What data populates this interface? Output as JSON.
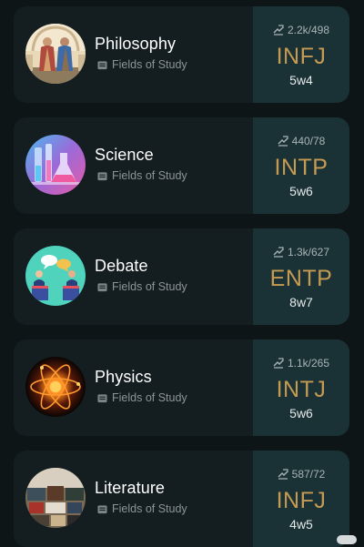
{
  "cards": [
    {
      "name": "Philosophy",
      "category": "Fields of Study",
      "votes": "2.2k/498",
      "type": "INFJ",
      "enneagram": "5w4",
      "avatar_icon": "philosophers-painting-avatar"
    },
    {
      "name": "Science",
      "category": "Fields of Study",
      "votes": "440/78",
      "type": "INTP",
      "enneagram": "5w6",
      "avatar_icon": "lab-glassware-avatar"
    },
    {
      "name": "Debate",
      "category": "Fields of Study",
      "votes": "1.3k/627",
      "type": "ENTP",
      "enneagram": "8w7",
      "avatar_icon": "debaters-podium-avatar"
    },
    {
      "name": "Physics",
      "category": "Fields of Study",
      "votes": "1.1k/265",
      "type": "INTJ",
      "enneagram": "5w6",
      "avatar_icon": "atom-avatar"
    },
    {
      "name": "Literature",
      "category": "Fields of Study",
      "votes": "587/72",
      "type": "INFJ",
      "enneagram": "4w5",
      "avatar_icon": "books-avatar"
    }
  ],
  "colors": {
    "background": "#0e1517",
    "card": "#141e20",
    "card_right": "#1a3236",
    "type_text": "#c59a52"
  }
}
